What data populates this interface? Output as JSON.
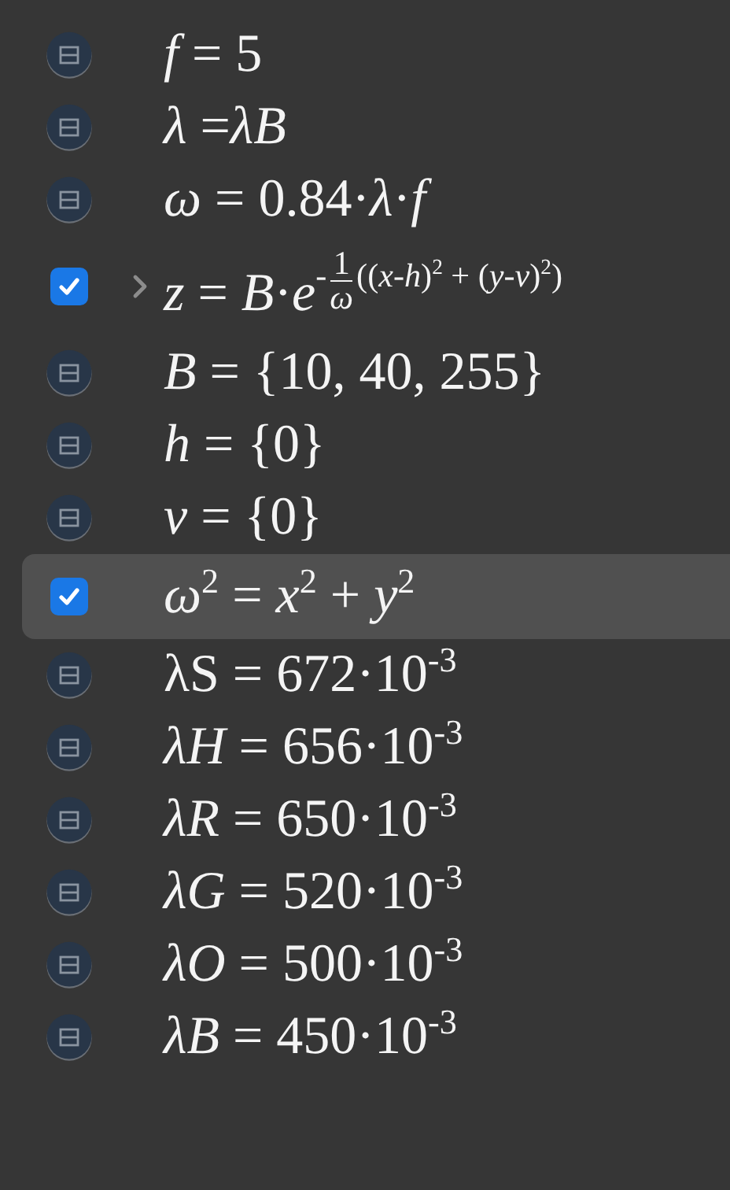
{
  "equations": [
    {
      "kind": "definition",
      "text": "*f* = 5",
      "selected": false
    },
    {
      "kind": "definition",
      "text": "*λ* =*λB*",
      "selected": false
    },
    {
      "kind": "definition",
      "text": "*ω* = 0.84·*λ*·*f*",
      "selected": false
    },
    {
      "kind": "graph",
      "checked": true,
      "expanded": false,
      "selected": false,
      "text": "*z* = *B*·*e*",
      "exponent": {
        "sign": "-",
        "numerator": "1",
        "denominator": "*ω*",
        "tail": "((*x*-*h*)$^{2}$ + (*y*-*v*)$^{2}$)"
      }
    },
    {
      "kind": "definition",
      "text": "*B* = {10, 40, 255}",
      "selected": false
    },
    {
      "kind": "definition",
      "text": "*h* = {0}",
      "selected": false
    },
    {
      "kind": "definition",
      "text": "*v* = {0}",
      "selected": false
    },
    {
      "kind": "graph",
      "checked": true,
      "selected": true,
      "text": "*ω*$^{2}$ = *x*$^{2}$ + *y*$^{2}$"
    },
    {
      "kind": "definition",
      "text": "λS = 672·10$^{-3}$",
      "selected": false
    },
    {
      "kind": "definition",
      "text": "*λH* = 656·10$^{-3}$",
      "selected": false
    },
    {
      "kind": "definition",
      "text": "*λR* = 650·10$^{-3}$",
      "selected": false
    },
    {
      "kind": "definition",
      "text": "*λG* = 520·10$^{-3}$",
      "selected": false
    },
    {
      "kind": "definition",
      "text": "*λO* = 500·10$^{-3}$",
      "selected": false
    },
    {
      "kind": "definition",
      "text": "*λB* = 450·10$^{-3}$",
      "selected": false
    }
  ]
}
